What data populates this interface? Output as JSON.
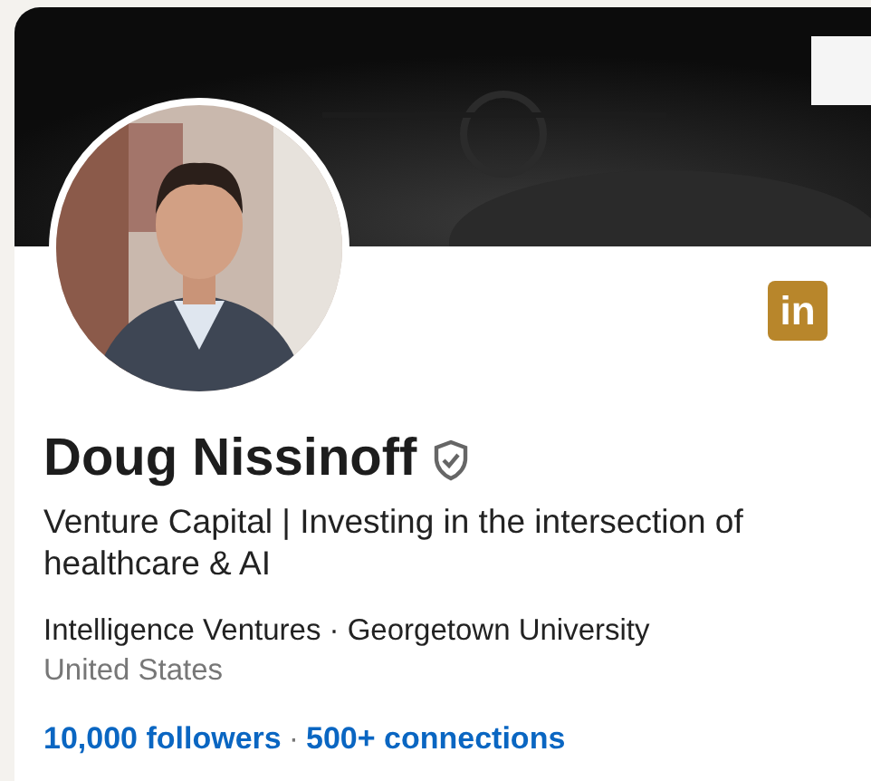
{
  "profile": {
    "badge_text": "in",
    "name": "Doug Nissinoff",
    "verified": true,
    "headline": "Venture Capital | Investing in the intersection of healthcare & AI",
    "affiliations": "Intelligence Ventures · Georgetown University",
    "location": "United States",
    "followers": "10,000 followers",
    "separator": "·",
    "connections": "500+ connections"
  }
}
